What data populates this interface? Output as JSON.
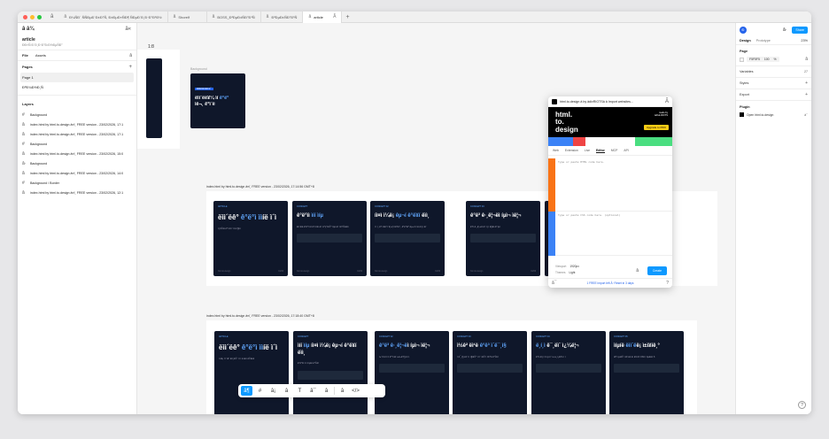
{
  "tabs": [
    {
      "label": "Ð¼ÑÐ´ ÑÑÐµÐ´Ð±Ð°Ñ, Ð±ÐµÐ»ÑÐ¶ ÑÐµÐ´Ð¸Ð·Ð°Ð¹Ð½",
      "active": false
    },
    {
      "label": "Shorelf",
      "active": false
    },
    {
      "label": "BOSS_Ð²ÐµÐ±ÑÐ°Ð¹Ñ",
      "active": false
    },
    {
      "label": "Ð²ÐµÐ±ÑÐ°Ð¹Ñ",
      "active": false
    },
    {
      "label": "article",
      "active": true
    }
  ],
  "left": {
    "file_name": "article",
    "file_sub": "ÐÐ»Ñ Ð´Ð¸Ð·Ð°Ð¹Ð½ÐµÑÐ°",
    "tab_file": "File",
    "tab_assets": "Assets",
    "pages_title": "Pages",
    "pages": [
      "Page 1",
      "ÐºÐ¾Ð½Ð¸Ñ"
    ],
    "layers_title": "Layers",
    "layers": [
      {
        "icon": "#",
        "name": "Background"
      },
      {
        "icon": "â",
        "name": "index.html by html.to.design â¤ï¸ FREE version - 23/02/2026, 17:1"
      },
      {
        "icon": "â",
        "name": "index.html by html.to.design â¤ï¸ FREE version - 23/02/2026, 17:1"
      },
      {
        "icon": "#",
        "name": "Background"
      },
      {
        "icon": "â",
        "name": "index.html by html.to.design â¤ï¸ FREE version - 23/02/2026, 15:0"
      },
      {
        "icon": "â·",
        "name": "Background"
      },
      {
        "icon": "â",
        "name": "index.html by html.to.design â¤ï¸ FREE version - 23/02/2026, 14:0"
      },
      {
        "icon": "#",
        "name": "Background / Border"
      },
      {
        "icon": "â",
        "name": "index.html by html.to.design â¤ï¸ FREE version - 23/02/2026, 12:1"
      }
    ]
  },
  "canvas": {
    "bg_label": "Background",
    "hero": {
      "tag": "ÐÐÐ¢Ð ÐÐ Ð¯",
      "title_a": "ëìì´ëë¥¼ ìí ",
      "title_hl": "ê°ë°",
      "title_b": "ìë¬¸ ê°ì´ë"
    },
    "frame1_label": "index.html by html.to.design â¤ï¸ FREE version - 23/02/2026, 17:14:56 GMT+8",
    "frame2_label": "index.html by html.to.design â¤ï¸ FREE version - 23/02/2026, 17:18:40 GMT+8",
    "row1": [
      {
        "tag": "ARTICLE",
        "pre": "ëìì´ëê° ",
        "hl": "ê°ë°ì ìì",
        "post": "íë ì´ì ",
        "p": "ìí¸ìì©íë ê°ì´ëì í´ì ìë ì§ì¤",
        "big": true
      },
      {
        "tag": "CONCEPT",
        "pre": "ê°ë°ìì ",
        "hl": "ìíí ìíµ",
        "post": "",
        "p": "ëìì´ëìë ê°ë°ìì ê´ê³ì ìì¤ì ëí´ ê°ì¡°íë©° ìíµì ëí´ ìê°í©ëë¤",
        "big": false
      },
      {
        "tag": "CONCEPT 02",
        "pre": "íì¤ì ì¼ë¡ ",
        "hl": "êµ¬í ê°ë¥í",
        "post": " ëìì¸",
        "p": "ì ì ì¸ ê°ì ì¤ê³ ì´ë¦¬ì¦ì ìê°íê³ , ê°ë°ìê° êµ¬íí  ì ìë ëìì¸ì ëí´",
        "big": false
      },
      {
        "tag": "CONCEPT 03",
        "pre": "ê°ë³ ê·¸ë¦¬ëì",
        "hl": "",
        "post": " íµì¬ ìë¦¬",
        "p": "ë°ìí ê·¸ë¦¬ëì ëí´ ìì¸í ë§íë ëª¨ìµì",
        "big": false
      },
      {
        "tag": "CONCEPT 04",
        "pre": "",
        "hl": "rem",
        "post": " ë¯¸ëì´",
        "p": "íë¡ì í¸ìì ì¬ì©íë ë°©ë²",
        "big": false
      }
    ],
    "row2": [
      {
        "tag": "ARTICLE",
        "pre": "ëìì´ëê° ",
        "hl": "ê°ë°ì ìì",
        "post": "íë ì´ì ",
        "p": "ì ëë¡ ì´í´íê³  ëìì¸íë©´ ìì ì ë ëë¹ ë©ëë¤",
        "big": true
      },
      {
        "tag": "CONCEPT",
        "pre": "ìíí ",
        "hl": "ìíµ",
        "post": " íì¤ì ì¼ë¡ êµ¬í ê°ë¥í ëìì¸",
        "p": "ê°ë°ììì íì ì ìíµíë ë°©ë²",
        "big": false
      },
      {
        "tag": "CONCEPT 02",
        "pre": "",
        "hl": "ê°ë³ ê·¸ë¦¬ë",
        "post": "ì íµì¬ ìë¦¬",
        "p": "ì»¨íì´ë ìì ìì ë°°ì¹íë ì¬ë¬ê°ì§ ê·ì¹",
        "big": false
      },
      {
        "tag": "CONCEPT 03",
        "pre": "ì½ê² ëì¹ë ",
        "hl": "ê°ë³ ì´ë¯¸ì§",
        "post": "",
        "p": "ì´ë¯¸ì§ ë¹ì¨ì ì ì§íë©° ì ì²´ íë©´ì ì±ì°ë ë°©ë²",
        "big": false
      },
      {
        "tag": "CONCEPT 04",
        "pre": "",
        "hl": "ë¸í¸ì",
        "post": " ë¯¸ëì´ ì¿¼ë¦¬",
        "p": "ë°ìí ëìì¸ì ìì ë¸ë ì´í¬í¬ì¸í¸ë¥¼ ì ì",
        "big": false
      },
      {
        "tag": "CONCEPT 05",
        "pre": "ìíµíë ",
        "hl": "ëìì´ë",
        "post": "ë¡ ì±ì¥íê¸°",
        "p": "ìê°ì ìµíë©´ ëìì´ëë ë¹ ë¥´ê² ì±ì¥í  ì ììµëë¤ ð",
        "big": false
      }
    ],
    "card_foot_left": "html.to.design",
    "card_foot_right": "01/06"
  },
  "plugin": {
    "title": "html.to.design â by âdivRIOTSâ â Import websites...",
    "logo_lines": [
      "html.",
      "to.",
      "design"
    ],
    "made_by": "made by",
    "brand": "âdivâ RIOTS",
    "upgrade": "Upgrade to PRO",
    "tabs": [
      "Web",
      "Extension",
      "Live",
      "Editor",
      "MCP",
      "API"
    ],
    "active_tab": "Editor",
    "html_placeholder": "Type or paste HTML code here.",
    "css_placeholder": "Type or paste CSS code here. (optional)",
    "viewport_label": "Viewport",
    "viewport_value": "1920px",
    "theme_label": "Themes",
    "theme_value": "Light",
    "create": "Create",
    "footer": "1 FREE import left Â· Reset in 3 days"
  },
  "right": {
    "avatar": "Ð",
    "share": "Share",
    "tab_design": "Design",
    "tab_prototype": "Prototype",
    "zoom": "23%",
    "page_title": "Page",
    "page_color": "F5F5F5",
    "page_opacity": "100",
    "page_opacity_unit": "%",
    "variables": "Variables",
    "variables_count": "27",
    "styles": "Styles",
    "export": "Export",
    "plugin_title": "Plugin",
    "plugin_item": "Open html.to.design"
  },
  "colors": {
    "accent": "#0d99ff",
    "card_bg": "#0f172a",
    "card_highlight": "#60a5fa"
  }
}
